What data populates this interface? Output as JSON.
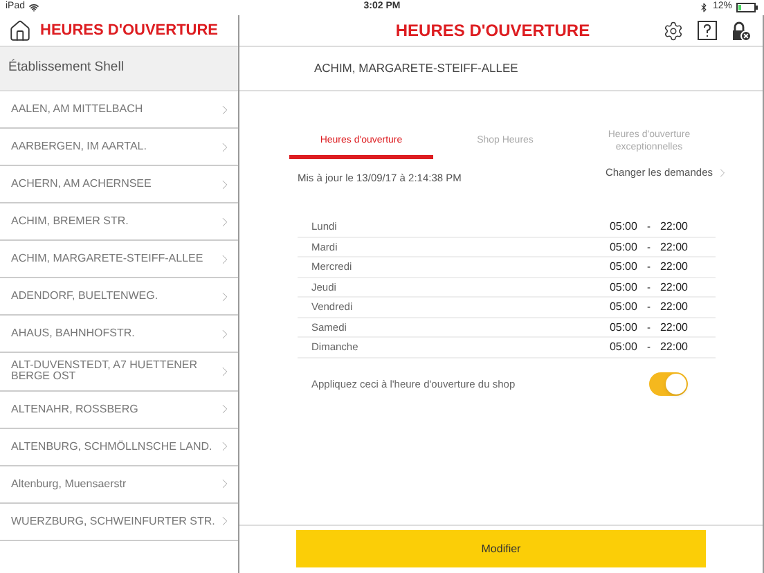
{
  "status_bar": {
    "device": "iPad",
    "time": "3:02 PM",
    "battery": "12%"
  },
  "sidebar": {
    "title": "HEURES D'OUVERTURE",
    "section": "Établissement Shell",
    "items": [
      {
        "label": "AALEN, AM MITTELBACH"
      },
      {
        "label": "AARBERGEN, IM AARTAL."
      },
      {
        "label": "ACHERN, AM ACHERNSEE"
      },
      {
        "label": "ACHIM, BREMER STR."
      },
      {
        "label": "ACHIM, MARGARETE-STEIFF-ALLEE"
      },
      {
        "label": "ADENDORF, BUELTENWEG."
      },
      {
        "label": "AHAUS, BAHNHOFSTR."
      },
      {
        "label": "ALT-DUVENSTEDT, A7 HUETTENER BERGE OST"
      },
      {
        "label": "ALTENAHR, ROSSBERG"
      },
      {
        "label": "ALTENBURG, SCHMÖLLNSCHE LAND."
      },
      {
        "label": "Altenburg, Muensaerstr"
      },
      {
        "label": "WUERZBURG, SCHWEINFURTER STR."
      }
    ]
  },
  "main": {
    "title": "HEURES D'OUVERTURE",
    "station": "ACHIM, MARGARETE-STEIFF-ALLEE",
    "tabs": [
      {
        "label": "Heures d'ouverture",
        "selected": true
      },
      {
        "label": "Shop Heures",
        "selected": false
      },
      {
        "label": "Heures d'ouverture exceptionnelles",
        "selected": false
      }
    ],
    "updated": "Mis à jour le 13/09/17 à 2:14:38 PM",
    "change_link": "Changer les demandes",
    "schedule": [
      {
        "day": "Lundi",
        "open": "05:00",
        "separator": "-",
        "close": "22:00"
      },
      {
        "day": "Mardi",
        "open": "05:00",
        "separator": "-",
        "close": "22:00"
      },
      {
        "day": "Mercredi",
        "open": "05:00",
        "separator": "-",
        "close": "22:00"
      },
      {
        "day": "Jeudi",
        "open": "05:00",
        "separator": "-",
        "close": "22:00"
      },
      {
        "day": "Vendredi",
        "open": "05:00",
        "separator": "-",
        "close": "22:00"
      },
      {
        "day": "Samedi",
        "open": "05:00",
        "separator": "-",
        "close": "22:00"
      },
      {
        "day": "Dimanche",
        "open": "05:00",
        "separator": "-",
        "close": "22:00"
      }
    ],
    "apply_to_shop": {
      "label": "Appliquez ceci à l'heure d'ouverture du shop",
      "on": true
    },
    "modify_button": "Modifier"
  }
}
